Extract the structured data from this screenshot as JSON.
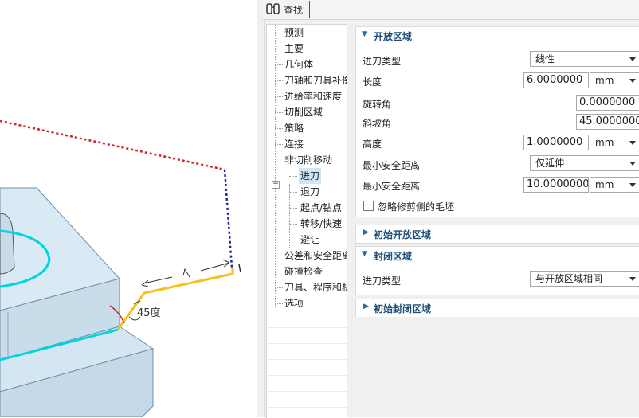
{
  "search": {
    "label": "查找",
    "value": ""
  },
  "viewport": {
    "angle_label": "45度"
  },
  "tree": {
    "items": [
      {
        "label": "预测"
      },
      {
        "label": "主要"
      },
      {
        "label": "几何体"
      },
      {
        "label": "刀轴和刀具补偿"
      },
      {
        "label": "进给率和速度"
      },
      {
        "label": "切削区域"
      },
      {
        "label": "策略"
      },
      {
        "label": "连接"
      },
      {
        "label": "非切削移动"
      },
      {
        "label": "进刀"
      },
      {
        "label": "退刀"
      },
      {
        "label": "起点/钻点"
      },
      {
        "label": "转移/快速"
      },
      {
        "label": "避让"
      },
      {
        "label": "公差和安全距离"
      },
      {
        "label": "碰撞检查"
      },
      {
        "label": "刀具、程序和机床"
      },
      {
        "label": "选项"
      }
    ],
    "selected": "进刀"
  },
  "open_area": {
    "title": "开放区域",
    "entry_type": {
      "label": "进刀类型",
      "value": "线性"
    },
    "length": {
      "label": "长度",
      "value": "6.0000000",
      "unit": "mm"
    },
    "rotation_angle": {
      "label": "旋转角",
      "value": "0.0000000"
    },
    "ramp_angle": {
      "label": "斜坡角",
      "value": "45.0000000"
    },
    "height": {
      "label": "高度",
      "value": "1.0000000",
      "unit": "mm"
    },
    "min_clearance_1": {
      "label": "最小安全距离",
      "value": "仅延伸"
    },
    "min_clearance_2": {
      "label": "最小安全距离",
      "value": "10.0000000",
      "unit": "mm"
    },
    "ignore_trim": {
      "label": "忽略修剪侧的毛坯",
      "checked": false
    }
  },
  "initial_open_area": {
    "title": "初始开放区域"
  },
  "closed_area": {
    "title": "封闭区域",
    "entry_type": {
      "label": "进刀类型",
      "value": "与开放区域相同"
    }
  },
  "initial_closed_area": {
    "title": "初始封闭区域"
  },
  "colors": {
    "accent_title": "#1f4e79",
    "selection": "#cce6f7",
    "toolpath_cyan": "#00d5e0",
    "entry_yellow": "#f5c21b"
  }
}
